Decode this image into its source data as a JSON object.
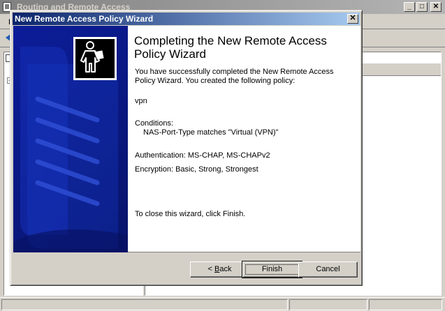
{
  "background_window": {
    "title": "Routing and Remote Access",
    "menu_fragment": "F",
    "minimize_glyph": "_",
    "maximize_glyph": "□",
    "close_glyph": "✕"
  },
  "wizard": {
    "title": "New Remote Access Policy Wizard",
    "close_glyph": "✕",
    "heading": "Completing the New Remote Access Policy Wizard",
    "intro": "You have successfully completed the New Remote Access Policy Wizard. You created the following policy:",
    "policy_name": "vpn",
    "conditions_label": "Conditions:",
    "condition_detail": "NAS-Port-Type matches \"Virtual (VPN)\"",
    "authentication": "Authentication: MS-CHAP, MS-CHAPv2",
    "encryption": "Encryption: Basic, Strong, Strongest",
    "closing_text": "To close this wizard, click Finish.",
    "buttons": {
      "back_prefix": "< ",
      "back_accel": "B",
      "back_rest": "ack",
      "finish": "Finish",
      "cancel": "Cancel"
    },
    "icon": "wizard-person-icon"
  },
  "colors": {
    "title_active": "#0a246a",
    "title_inactive": "#808080",
    "watermark_blue": "#0c1d9a",
    "dialog_face": "#d4d0c8"
  }
}
